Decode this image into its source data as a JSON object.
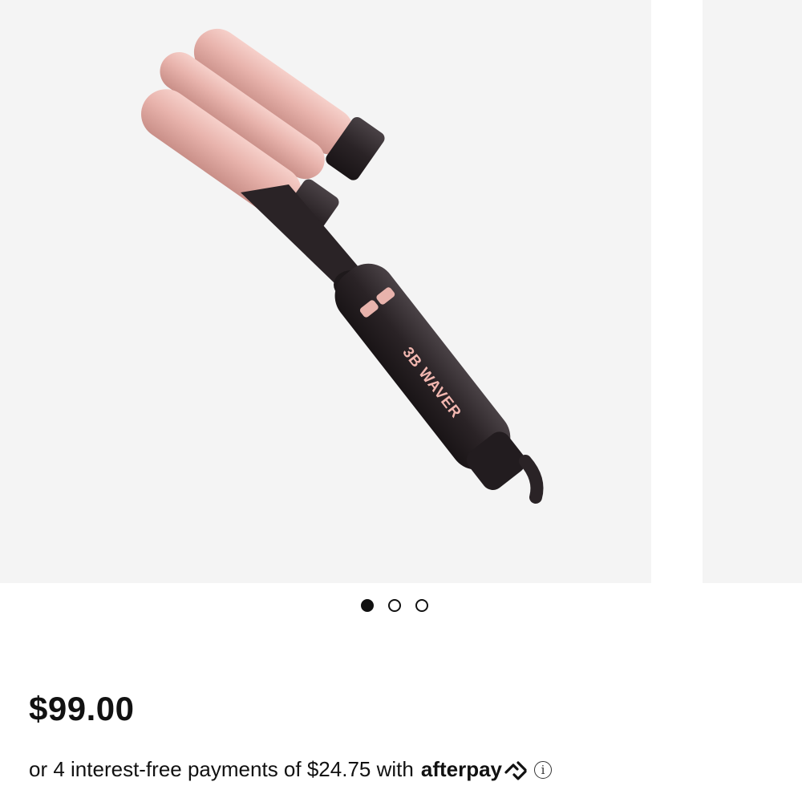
{
  "product": {
    "image_brand_text": "3B WAVER",
    "price": "$99.00",
    "installment_prefix": "or 4 interest-free payments of",
    "installment_amount": "$24.75",
    "installment_with": "with",
    "afterpay_label": "afterpay",
    "info_icon": "i"
  },
  "carousel": {
    "slide_count": 3,
    "active_index": 0
  },
  "colors": {
    "barrel_pink": "#e8b3ac",
    "handle_black": "#2a2326",
    "background_gray": "#f4f4f4"
  }
}
